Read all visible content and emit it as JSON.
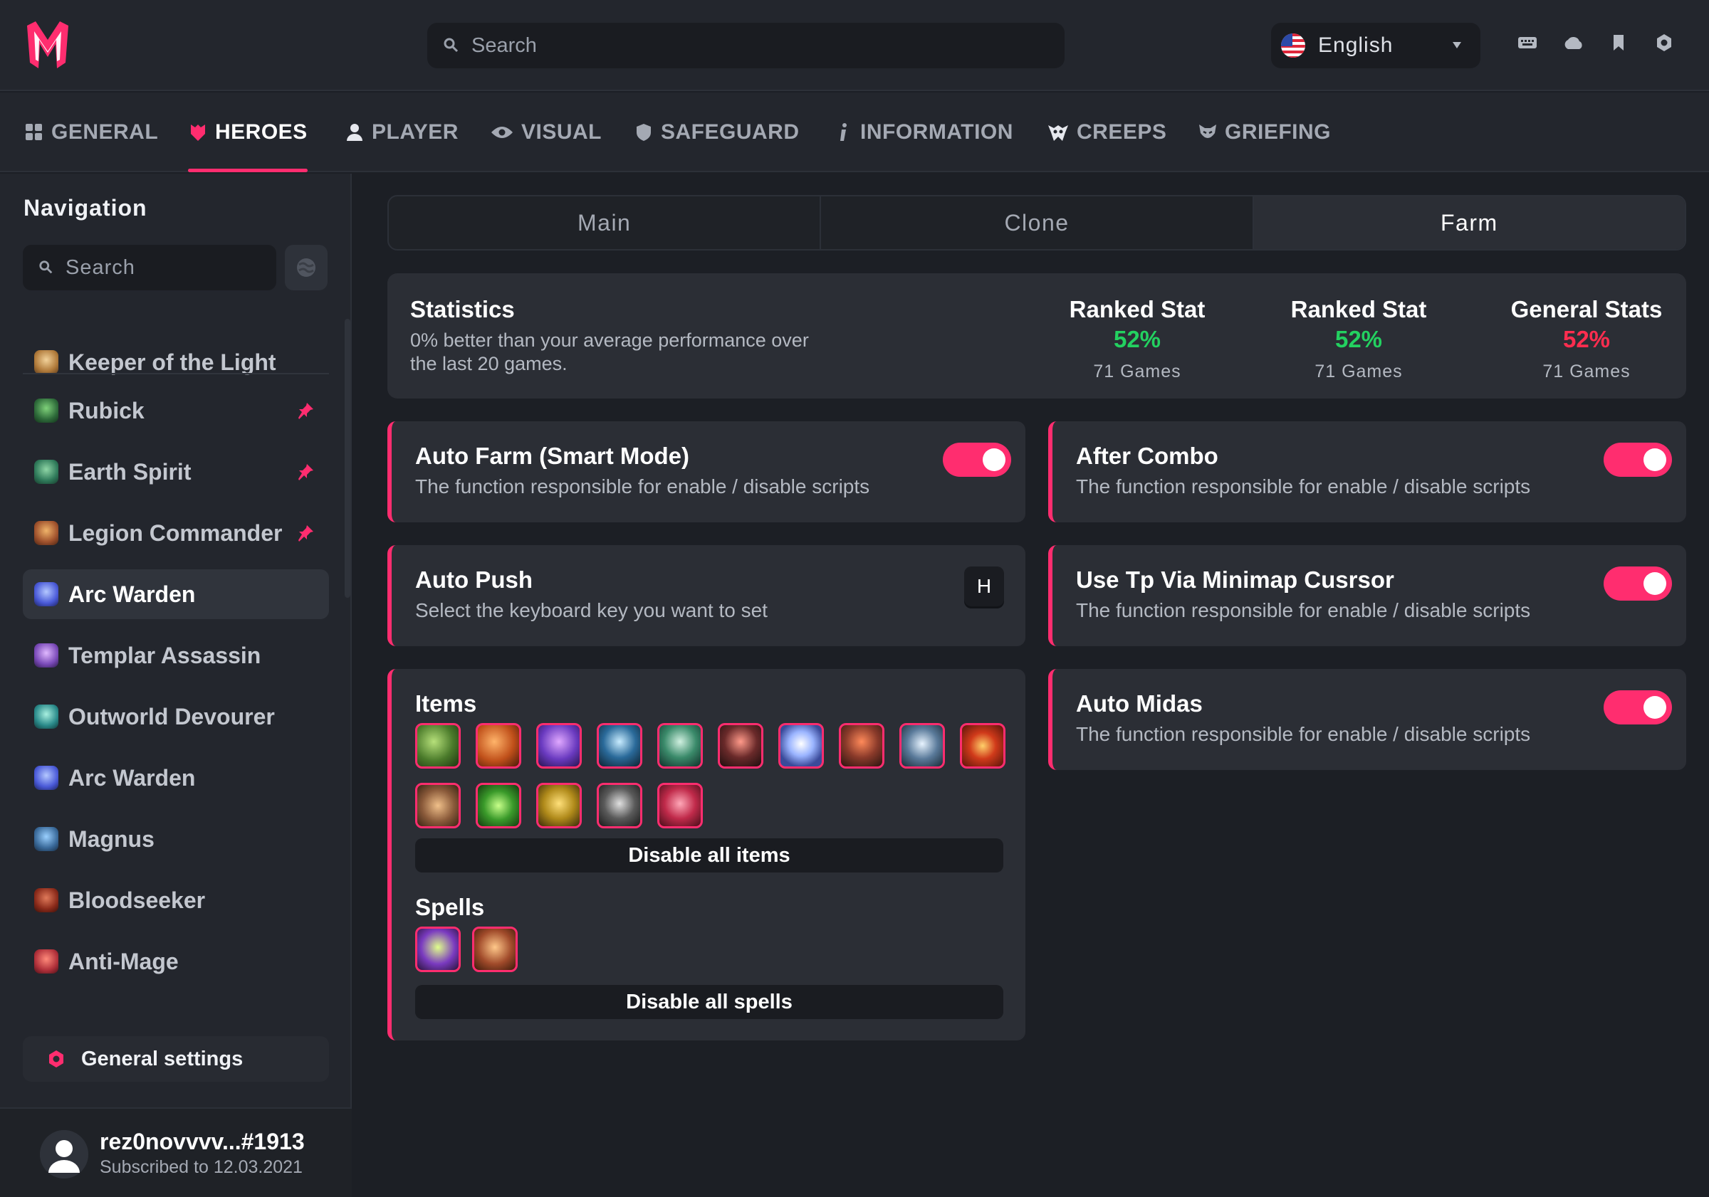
{
  "header": {
    "search_placeholder": "Search",
    "language": "English",
    "icons": [
      "keyboard-icon",
      "cloud-icon",
      "bookmark-icon",
      "settings-icon"
    ]
  },
  "tabs": [
    {
      "label": "GENERAL",
      "icon": "grid-icon"
    },
    {
      "label": "HEROES",
      "icon": "hero-mask-icon",
      "active": true
    },
    {
      "label": "PLAYER",
      "icon": "person-icon"
    },
    {
      "label": "VISUAL",
      "icon": "eye-icon"
    },
    {
      "label": "SAFEGUARD",
      "icon": "shield-icon"
    },
    {
      "label": "INFORMATION",
      "icon": "info-icon"
    },
    {
      "label": "CREEPS",
      "icon": "creep-icon"
    },
    {
      "label": "GRIEFING",
      "icon": "griefing-icon"
    }
  ],
  "sidebar": {
    "title": "Navigation",
    "search_placeholder": "Search",
    "heroes": [
      {
        "name": "Keeper of the Light",
        "pinned": false
      },
      {
        "name": "Rubick",
        "pinned": true
      },
      {
        "name": "Earth Spirit",
        "pinned": true
      },
      {
        "name": "Legion Commander",
        "pinned": true
      },
      {
        "name": "Arc Warden",
        "pinned": false,
        "selected": true
      },
      {
        "name": "Templar Assassin",
        "pinned": false
      },
      {
        "name": "Outworld Devourer",
        "pinned": false
      },
      {
        "name": "Arc Warden",
        "pinned": false
      },
      {
        "name": "Magnus",
        "pinned": false
      },
      {
        "name": "Bloodseeker",
        "pinned": false
      },
      {
        "name": "Anti-Mage",
        "pinned": false
      }
    ],
    "general_settings": "General settings",
    "user": {
      "name": "rez0novvvv...#1913",
      "subscription": "Subscribed to 12.03.2021"
    }
  },
  "subtabs": [
    {
      "label": "Main"
    },
    {
      "label": "Clone"
    },
    {
      "label": "Farm",
      "active": true
    }
  ],
  "statistics": {
    "title": "Statistics",
    "description": "0% better than your average performance over the last 20 games.",
    "columns": [
      {
        "label": "Ranked Stat",
        "value": "52%",
        "games": "71 Games",
        "color": "#23d160"
      },
      {
        "label": "Ranked Stat",
        "value": "52%",
        "games": "71 Games",
        "color": "#23d160"
      },
      {
        "label": "General Stats",
        "value": "52%",
        "games": "71 Games",
        "color": "#ff2d4f"
      }
    ]
  },
  "cards": {
    "auto_farm": {
      "title": "Auto Farm (Smart Mode)",
      "desc": "The function responsible for enable / disable scripts",
      "enabled": true
    },
    "auto_push": {
      "title": "Auto Push",
      "desc": "Select the keyboard key you want to set",
      "key": "H"
    },
    "after_combo": {
      "title": "After Combo",
      "desc": "The function responsible for enable / disable scripts",
      "enabled": true
    },
    "use_tp": {
      "title": "Use Tp Via Minimap Cusrsor",
      "desc": "The function responsible for enable / disable scripts",
      "enabled": true
    },
    "auto_midas": {
      "title": "Auto Midas",
      "desc": "The function responsible for enable / disable scripts",
      "enabled": true
    }
  },
  "items_panel": {
    "items_title": "Items",
    "items_count": 15,
    "disable_items": "Disable all items",
    "spells_title": "Spells",
    "spells_count": 2,
    "disable_spells": "Disable all spells"
  },
  "colors": {
    "accent": "#ff2d6f",
    "background": "#1c1f25",
    "panel": "#2b2e35",
    "positive": "#23d160",
    "negative": "#ff2d4f"
  }
}
